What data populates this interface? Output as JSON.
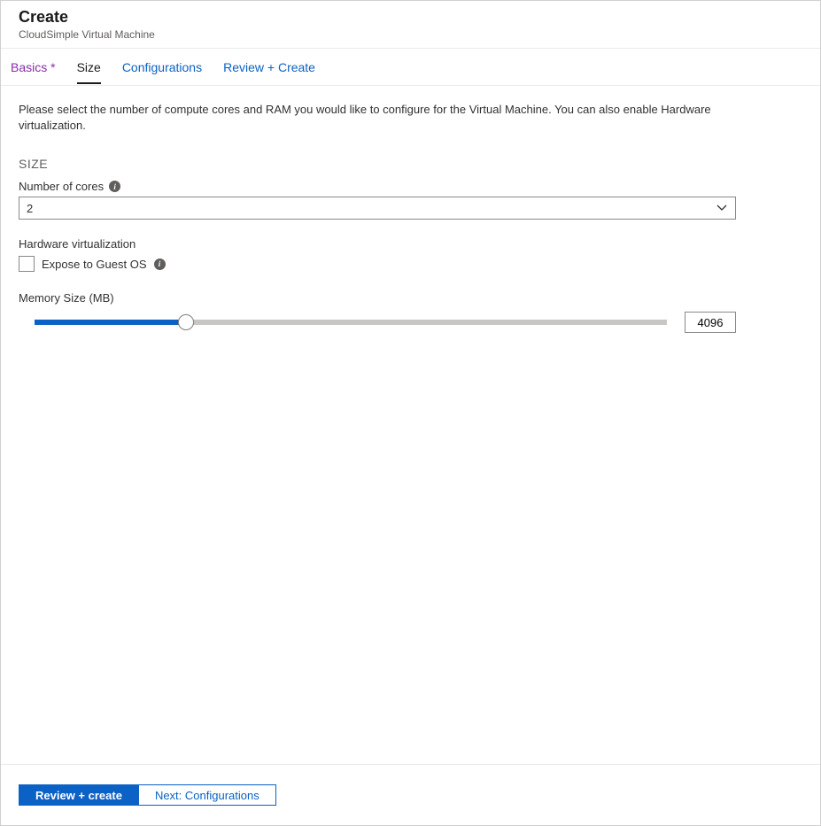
{
  "header": {
    "title": "Create",
    "subtitle": "CloudSimple Virtual Machine"
  },
  "tabs": [
    {
      "label": "Basics *",
      "state": "visited"
    },
    {
      "label": "Size",
      "state": "active"
    },
    {
      "label": "Configurations",
      "state": "link"
    },
    {
      "label": "Review + Create",
      "state": "link"
    }
  ],
  "intro": "Please select the number of compute cores and RAM you would like to configure for the Virtual Machine. You can also enable Hardware virtualization.",
  "section_title": "SIZE",
  "cores": {
    "label": "Number of cores",
    "value": "2"
  },
  "hardware_virtualization": {
    "label": "Hardware virtualization",
    "checkbox_label": "Expose to Guest OS",
    "checked": false
  },
  "memory": {
    "label": "Memory Size (MB)",
    "value": "4096",
    "percent": 24
  },
  "footer": {
    "primary": "Review + create",
    "secondary": "Next: Configurations"
  }
}
